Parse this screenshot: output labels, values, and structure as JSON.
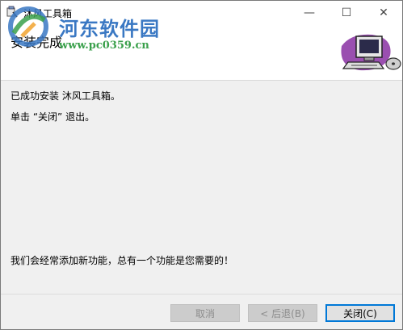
{
  "window": {
    "title": "沐风工具箱",
    "minimize_glyph": "—",
    "maximize_glyph": "☐",
    "close_glyph": "✕"
  },
  "header": {
    "title": "安装完成",
    "watermark_text": "河东软件园",
    "watermark_url": "www.pc0359.cn"
  },
  "content": {
    "line1": "已成功安装 沐风工具箱。",
    "line2": "单击 “关闭” 退出。",
    "line3": "我们会经常添加新功能，总有一个功能是您需要的！"
  },
  "buttons": {
    "cancel": "取消",
    "back": "< 后退(B)",
    "close": "关闭(C)"
  },
  "colors": {
    "accent": "#0078d7",
    "watermark_blue": "#3a78c3",
    "watermark_green": "#3aa04b"
  },
  "icons": {
    "app": "installer-icon",
    "header_art": "computer-with-disc-icon",
    "watermark": "hedong-logo-icon"
  }
}
